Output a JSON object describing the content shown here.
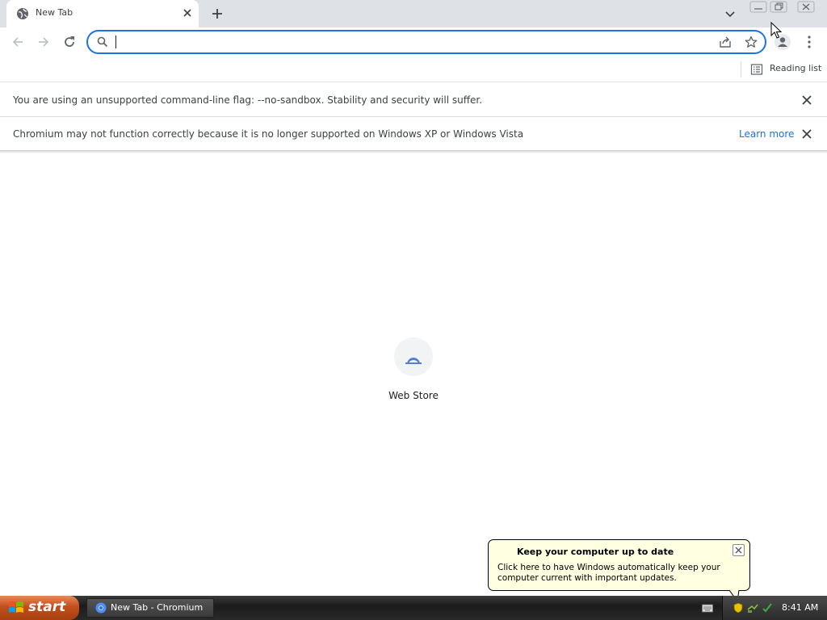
{
  "tab": {
    "title": "New Tab"
  },
  "omnibox": {
    "value": "",
    "placeholder": ""
  },
  "bookmarks_bar": {
    "reading_list_label": "Reading list"
  },
  "infobars": [
    {
      "message": "You are using an unsupported command-line flag: --no-sandbox. Stability and security will suffer."
    },
    {
      "message": "Chromium may not function correctly because it is no longer supported on Windows XP or Windows Vista",
      "link": "Learn more"
    }
  ],
  "shortcuts": [
    {
      "label": "Web Store"
    }
  ],
  "balloon": {
    "title": "Keep your computer up to date",
    "text": "Click here to have Windows automatically keep your computer current with important updates."
  },
  "taskbar": {
    "start_label": "start",
    "window_label": "New Tab - Chromium",
    "clock": "8:41 AM"
  },
  "colors": {
    "accent": "#1a73e8",
    "tabstrip": "#dee1e6",
    "balloon_bg": "#ffffe1",
    "start_button": "#c24e1d"
  }
}
